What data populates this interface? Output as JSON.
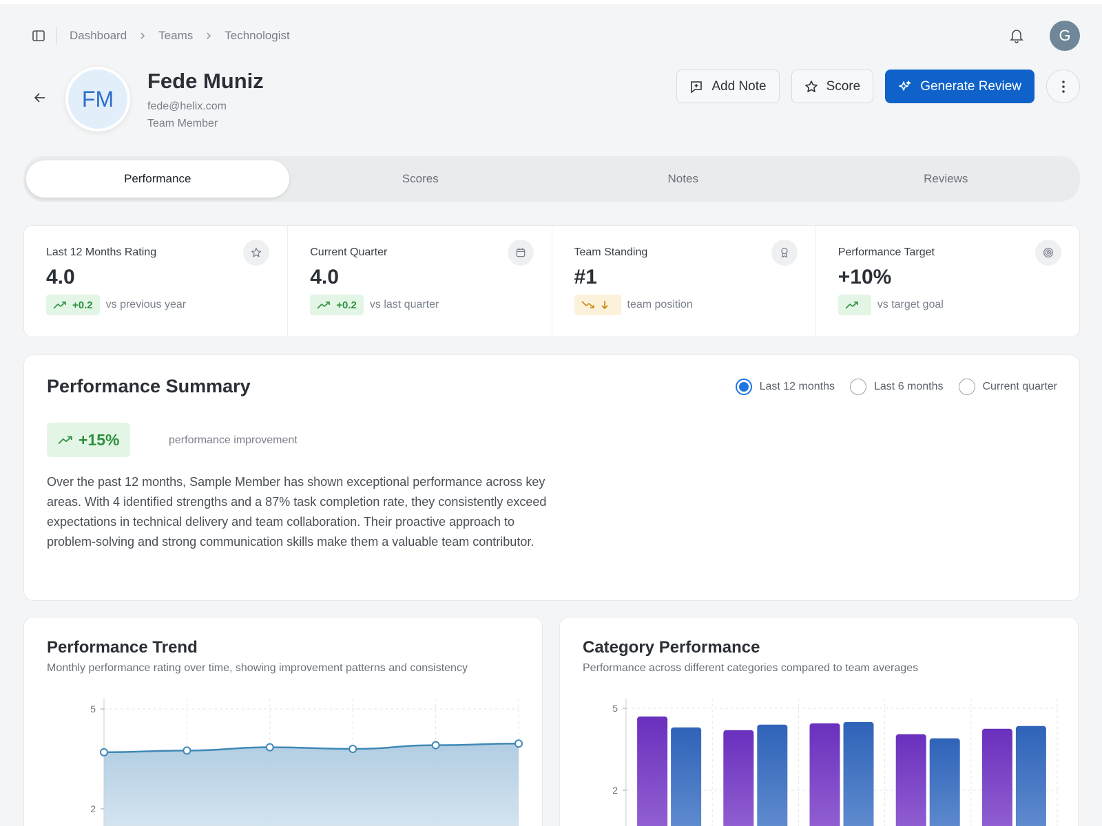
{
  "breadcrumb": [
    "Dashboard",
    "Teams",
    "Technologist"
  ],
  "user_avatar": "G",
  "profile": {
    "initials": "FM",
    "name": "Fede Muniz",
    "email": "fede@helix.com",
    "role": "Team Member"
  },
  "actions": {
    "add_note": "Add Note",
    "score": "Score",
    "generate_review": "Generate Review"
  },
  "tabs": [
    {
      "label": "Performance",
      "active": true
    },
    {
      "label": "Scores",
      "active": false
    },
    {
      "label": "Notes",
      "active": false
    },
    {
      "label": "Reviews",
      "active": false
    }
  ],
  "stats": [
    {
      "label": "Last 12 Months Rating",
      "value": "4.0",
      "badge": "+0.2",
      "badge_color": "green",
      "sub": "vs previous year",
      "icon": "star-icon"
    },
    {
      "label": "Current Quarter",
      "value": "4.0",
      "badge": "+0.2",
      "badge_color": "green",
      "sub": "vs last quarter",
      "icon": "calendar-icon"
    },
    {
      "label": "Team Standing",
      "value": "#1",
      "badge": "",
      "badge_color": "amber",
      "sub": "team position",
      "icon": "award-icon"
    },
    {
      "label": "Performance Target",
      "value": "+10%",
      "badge": "",
      "badge_color": "green",
      "sub": "vs target goal",
      "icon": "target-icon"
    }
  ],
  "summary": {
    "title": "Performance Summary",
    "periods": [
      {
        "label": "Last 12 months",
        "checked": true
      },
      {
        "label": "Last 6 months",
        "checked": false
      },
      {
        "label": "Current quarter",
        "checked": false
      }
    ],
    "improvement": "+15%",
    "improvement_label": "performance improvement",
    "text": "Over the past 12 months, Sample Member has shown exceptional performance across key areas. With 4 identified strengths and a 87% task completion rate, they consistently exceed expectations in technical delivery and team collaboration. Their proactive approach to problem-solving and strong communication skills make them a valuable team contributor."
  },
  "trend": {
    "title": "Performance Trend",
    "subtitle": "Monthly performance rating over time, showing improvement patterns and consistency"
  },
  "category": {
    "title": "Category Performance",
    "subtitle": "Performance across different categories compared to team averages"
  },
  "colors": {
    "primary": "#0f62c9",
    "line": "#3f88b6",
    "bar_member": "#6b3fc0",
    "bar_team": "#3b6fc0",
    "positive": "#2e8f3f"
  },
  "chart_data": [
    {
      "type": "area",
      "y_ticks": [
        "5",
        "2"
      ],
      "values": [
        3.7,
        3.75,
        3.85,
        3.8,
        3.91,
        3.96
      ],
      "grid": true
    },
    {
      "type": "bar",
      "y_ticks": [
        "5",
        "2"
      ],
      "series": [
        {
          "values": [
            4.7,
            4.2,
            4.45,
            4.05,
            4.25
          ]
        },
        {
          "values": [
            4.3,
            4.4,
            4.5,
            3.9,
            4.35
          ]
        }
      ],
      "grid": true
    }
  ]
}
